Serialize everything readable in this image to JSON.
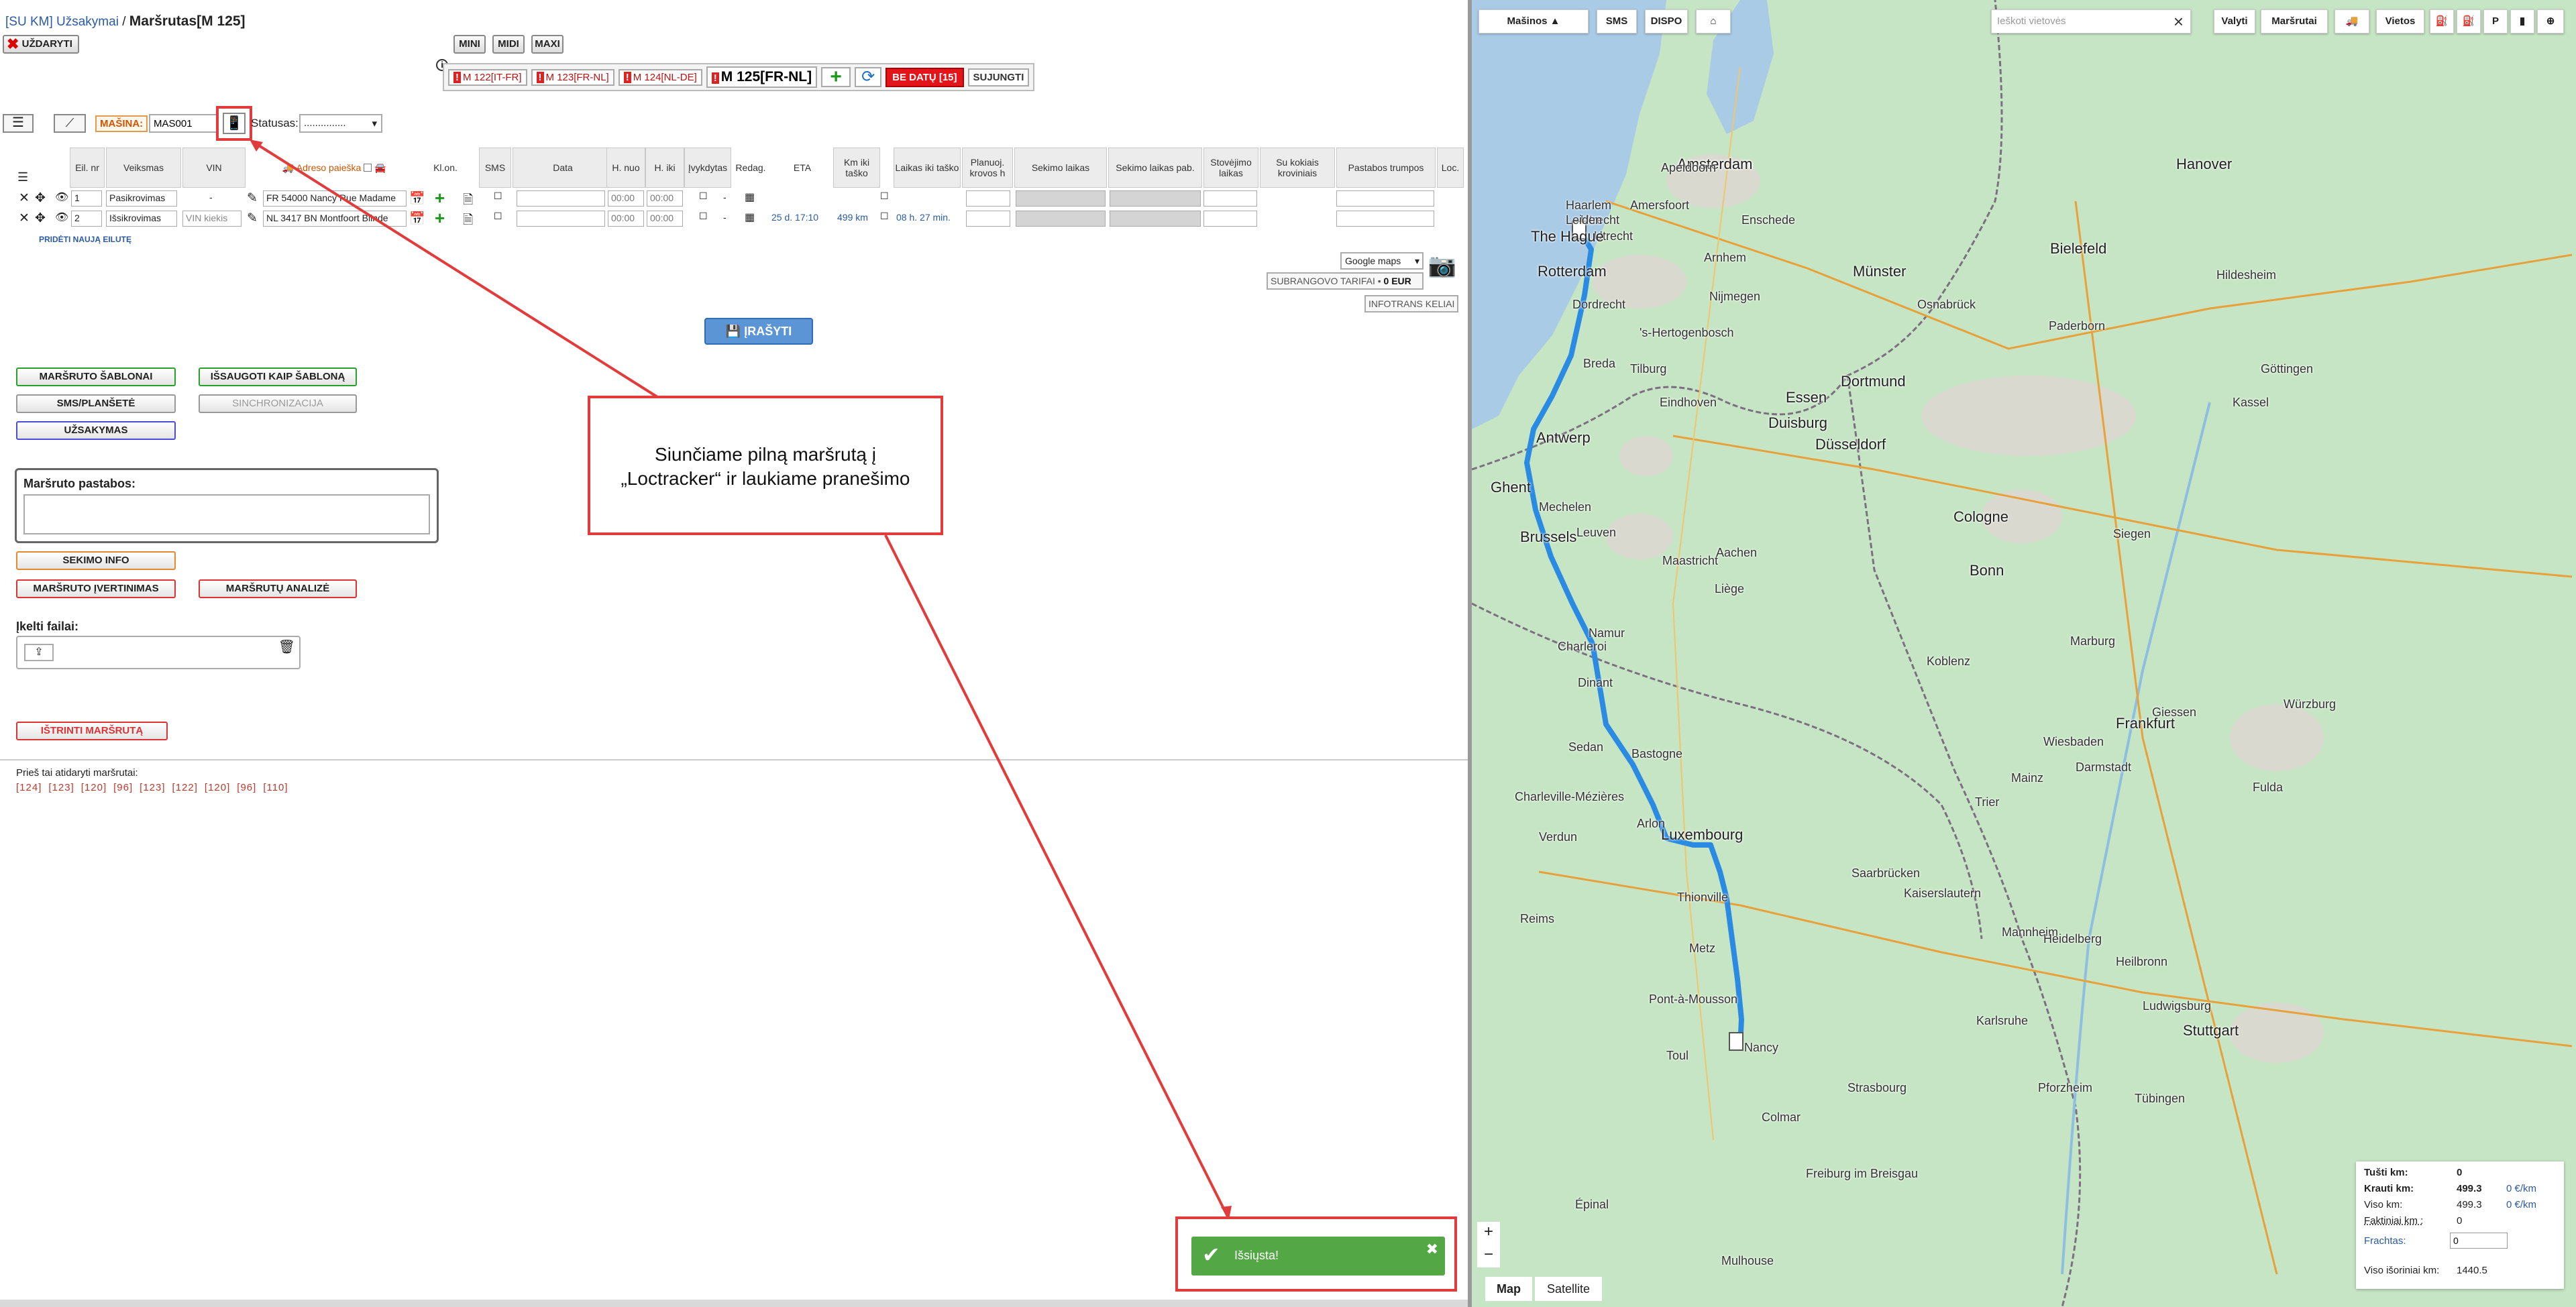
{
  "breadcrumb": {
    "link": "[SU KM] Užsakymai",
    "sep": " / ",
    "title": "Maršrutas[M 125]"
  },
  "toolbar": {
    "close": "UŽDARYTI",
    "sizes": [
      "MINI",
      "MIDI",
      "MAXI"
    ]
  },
  "tabs": {
    "items": [
      "M 122[IT-FR]",
      "M 123[FR-NL]",
      "M 124[NL-DE]"
    ],
    "active": "M 125[FR-NL]",
    "no_dates": "BE DATŲ [15]",
    "merge": "SUJUNGTI"
  },
  "machine": {
    "label": "MAŠINA:",
    "value": "MAS001"
  },
  "status": {
    "label": "Statusas:",
    "value": "..............."
  },
  "table": {
    "headers": [
      "Eil. nr",
      "Veiksmas",
      "VIN",
      "Adreso paieška",
      "Kl.on.",
      "SMS",
      "Data",
      "H. nuo",
      "H. iki",
      "Įvykdytas",
      "Redag.",
      "ETA",
      "Km iki taško",
      "Laikas iki taško",
      "Planuoj. krovos h",
      "Sekimo laikas",
      "Sekimo laikas pab.",
      "Stovėjimo laikas",
      "Su kokiais kroviniais",
      "Pastabos trumpos",
      "Loc."
    ],
    "rows": [
      {
        "nr": "1",
        "action": "Pasikrovimas",
        "vin": "-",
        "address": "FR 54000 Nancy Rue Madame",
        "from": "00:00",
        "to": "00:00",
        "done": "-",
        "eta": "",
        "km": "",
        "time": ""
      },
      {
        "nr": "2",
        "action": "Išsikrovimas",
        "vin_placeholder": "VIN kiekis",
        "address": "NL 3417 BN Montfoort Blinde",
        "from": "00:00",
        "to": "00:00",
        "done": "-",
        "eta": "25 d. 17:10",
        "km": "499 km",
        "time": "08 h. 27 min."
      }
    ],
    "add_row": "PRIDĖTI NAUJĄ EILUTĘ"
  },
  "map_select": "Google maps",
  "tarif": {
    "label": "SUBRANGOVO TARIFAI",
    "value": "0 EUR"
  },
  "infotrans": "INFOTRANS KELIAI",
  "save": "ĮRAŠYTI",
  "actions": {
    "templates": "MARŠRUTO ŠABLONAI",
    "save_template": "IŠSAUGOTI KAIP ŠABLONĄ",
    "sms": "SMS/PLANŠETĖ",
    "sync": "SINCHRONIZACIJA",
    "order": "UŽSAKYMAS",
    "tracking": "SEKIMO INFO",
    "rating": "MARŠRUTO ĮVERTINIMAS",
    "analysis": "MARŠRUTŲ ANALIZĖ",
    "delete": "IŠTRINTI MARŠRUTĄ"
  },
  "notes_label": "Maršruto pastabos:",
  "files_label": "Įkelti failai:",
  "prev_label": "Prieš tai atidaryti maršrutai:",
  "prev_links": [
    "[124]",
    "[123]",
    "[120]",
    "[96]",
    "[123]",
    "[122]",
    "[120]",
    "[96]",
    "[110]"
  ],
  "callout": {
    "line1": "Siunčiame pilną maršrutą į",
    "line2": "„Loctracker“ ir laukiame pranešimo"
  },
  "toast": {
    "message": "Išsiųsta!"
  },
  "map": {
    "controls": [
      "Mašinos ▲",
      "SMS",
      "DISPO",
      "Valyti",
      "Maršrutai",
      "Vietos"
    ],
    "search_placeholder": "Ieškoti vietovės",
    "cities": [
      "Amsterdam",
      "Utrecht",
      "The Hague",
      "Rotterdam",
      "Dordrecht",
      "Arnhem",
      "Nijmegen",
      "'s-Hertogenbosch",
      "Tilburg",
      "Breda",
      "Eindhoven",
      "Antwerp",
      "Ghent",
      "Brussels",
      "Leuven",
      "Mechelen",
      "Maastricht",
      "Liège",
      "Aachen",
      "Namur",
      "Charleroi",
      "Dinant",
      "Bastogne",
      "Luxembourg",
      "Arlon",
      "Thionville",
      "Metz",
      "Nancy",
      "Toul",
      "Pont-à-Mousson",
      "Reims",
      "Charleville-Mézières",
      "Trier",
      "Saarbrücken",
      "Kaiserslautern",
      "Mannheim",
      "Heidelberg",
      "Karlsruhe",
      "Strasbourg",
      "Stuttgart",
      "Frankfurt",
      "Wiesbaden",
      "Darmstadt",
      "Mainz",
      "Koblenz",
      "Bonn",
      "Cologne",
      "Düsseldorf",
      "Duisburg",
      "Essen",
      "Dortmund",
      "Münster",
      "Bielefeld",
      "Hanover",
      "Kassel",
      "Siegen",
      "Marburg",
      "Giessen",
      "Würzburg",
      "Freiburg im Breisgau",
      "Mulhouse",
      "Colmar",
      "Épinal",
      "Verdun",
      "Sedan",
      "Enschede",
      "Apeldoorn",
      "Amersfoort",
      "Leiden",
      "Haarlem",
      "Hildesheim",
      "Paderborn",
      "Göttingen",
      "Osnabrück",
      "Ludwigsburg",
      "Tübingen",
      "Pforzheim",
      "Heilbronn",
      "Fulda"
    ],
    "stats": {
      "empty_km": {
        "label": "Tušti km:",
        "value": "0"
      },
      "loaded_km": {
        "label": "Krauti km:",
        "value": "499.3",
        "rate": "0 €/km"
      },
      "total_km": {
        "label": "Viso km:",
        "value": "499.3",
        "rate": "0 €/km"
      },
      "actual_km": {
        "label": "Faktiniai km :",
        "value": "0"
      },
      "freight": {
        "label": "Frachtas:",
        "value": "0"
      },
      "outer_km": {
        "label": "Viso išoriniai km:",
        "value": "1440.5"
      }
    },
    "map_types": [
      "Map",
      "Satellite"
    ]
  }
}
